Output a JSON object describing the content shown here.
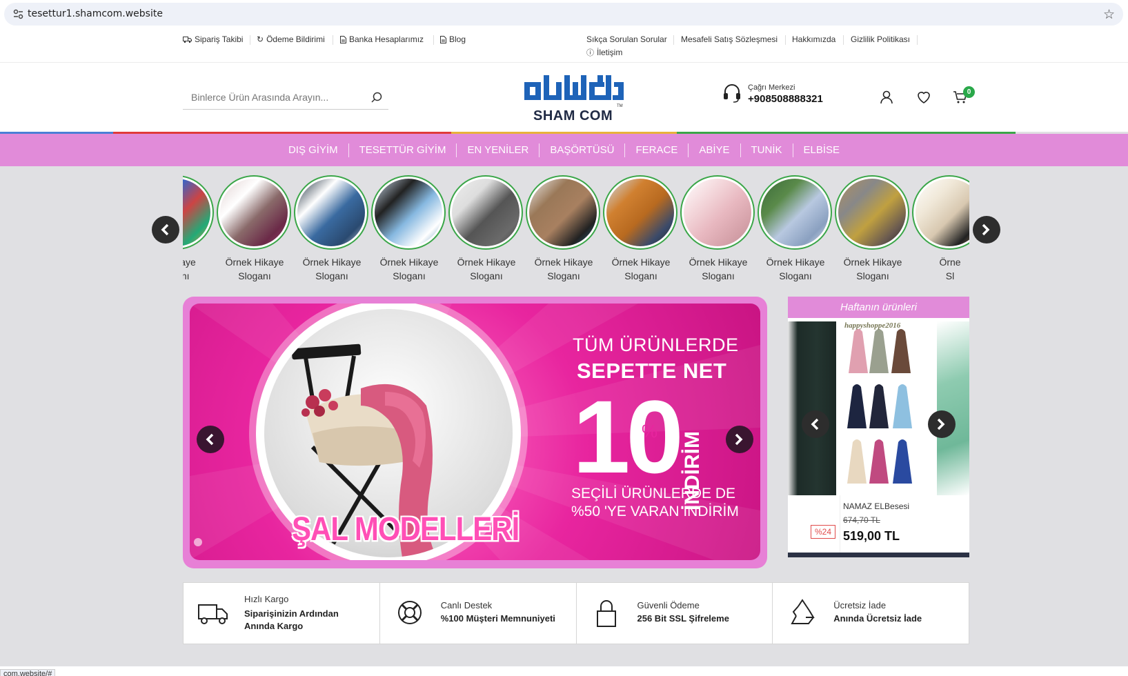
{
  "browser": {
    "url": "tesettur1.shamcom.website",
    "status_url": "com.website/#"
  },
  "top_links": {
    "left": [
      {
        "icon": "truck-icon",
        "label": "Sipariş Takibi"
      },
      {
        "icon": "refresh-icon",
        "label": "Ödeme Bildirimi"
      },
      {
        "icon": "document-icon",
        "label": "Banka Hesaplarımız"
      },
      {
        "icon": "document-icon",
        "label": "Blog"
      }
    ],
    "right": [
      {
        "label": "Sıkça Sorulan Sorular"
      },
      {
        "label": "Mesafeli Satış Sözleşmesi"
      },
      {
        "label": "Hakkımızda"
      },
      {
        "label": "Gizlilik Politikası"
      },
      {
        "icon": "info-icon",
        "label": "İletişim"
      }
    ]
  },
  "header": {
    "search_placeholder": "Binlerce Ürün Arasında Arayın...",
    "logo_text": "SHAM COM",
    "logo_tm": "TM",
    "call_label": "Çağrı Merkezi",
    "call_phone": "+908508888321",
    "cart_count": "0"
  },
  "stripe_colors": [
    "#4a7fd6",
    "#e03a3a",
    "#e03a3a",
    "#e03a3a",
    "#e8b23a",
    "#e8b23a",
    "#3aa648",
    "#3aa648",
    "#3aa648",
    "#e0e0e3"
  ],
  "nav": {
    "items": [
      "DIŞ GİYİM",
      "TESETTÜR GİYİM",
      "EN YENİLER",
      "BAŞÖRTÜSÜ",
      "FERACE",
      "ABİYE",
      "TUNİK",
      "ELBİSE"
    ],
    "bg_color": "#e18bd9"
  },
  "stories": {
    "items": [
      {
        "line1": "k Hikaye",
        "line2": "oganı"
      },
      {
        "line1": "Örnek Hikaye",
        "line2": "Sloganı"
      },
      {
        "line1": "Örnek Hikaye",
        "line2": "Sloganı"
      },
      {
        "line1": "Örnek Hikaye",
        "line2": "Sloganı"
      },
      {
        "line1": "Örnek Hikaye",
        "line2": "Sloganı"
      },
      {
        "line1": "Örnek Hikaye",
        "line2": "Sloganı"
      },
      {
        "line1": "Örnek Hikaye",
        "line2": "Sloganı"
      },
      {
        "line1": "Örnek Hikaye",
        "line2": "Sloganı"
      },
      {
        "line1": "Örnek Hikaye",
        "line2": "Sloganı"
      },
      {
        "line1": "Örnek Hikaye",
        "line2": "Sloganı"
      },
      {
        "line1": "Örne",
        "line2": "Sl"
      }
    ],
    "ring_color": "#3aa648"
  },
  "banner": {
    "title": "ŞAL MODELLERİ",
    "line1": "TÜM ÜRÜNLERDE",
    "line2": "SEPETTE NET",
    "big_number": "10",
    "percent": "%",
    "vertical": "İNDİRİM",
    "line3": "SEÇİLİ ÜRÜNLERDE DE",
    "line4": "%50 'YE VARAN İNDİRİM"
  },
  "weekly": {
    "heading": "Haftanın ürünleri",
    "watermark": "happyshoppe2016",
    "product_name": "NAMAZ ELBesesi",
    "old_price": "674,70 TL",
    "price": "519,00 TL",
    "discount": "%24"
  },
  "features": [
    {
      "icon": "truck-icon",
      "title": "Hızlı Kargo",
      "desc": "Siparişinizin Ardından Anında Kargo"
    },
    {
      "icon": "lifebuoy-icon",
      "title": "Canlı Destek",
      "desc": "%100 Müşteri Memnuniyeti"
    },
    {
      "icon": "lock-icon",
      "title": "Güvenli Ödeme",
      "desc": "256 Bit SSL Şifreleme"
    },
    {
      "icon": "recycle-icon",
      "title": "Ücretsiz İade",
      "desc": "Anında Ücretsiz İade"
    }
  ]
}
